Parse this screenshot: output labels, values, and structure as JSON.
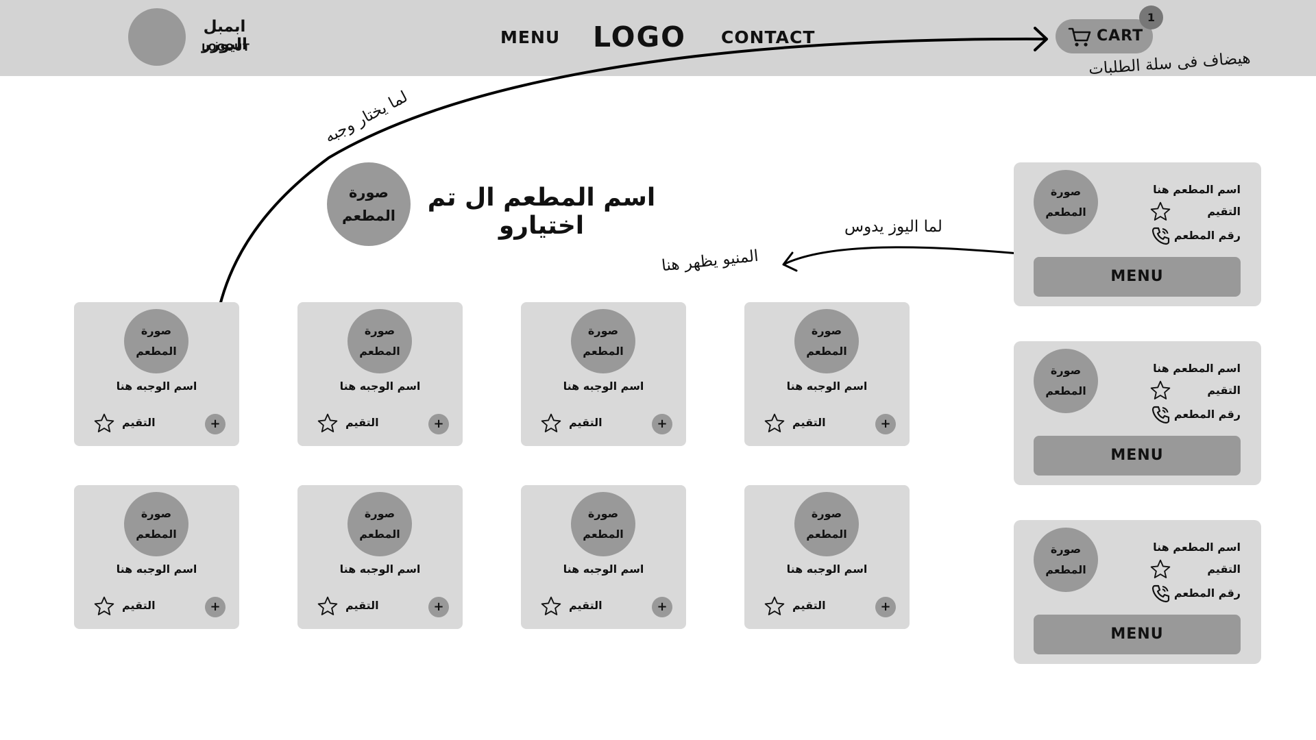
{
  "header": {
    "user_name": "ابمبل اليوزر",
    "logout_label": "LOGOUT",
    "nav_menu_label": "MENU",
    "logo_text": "LOGO",
    "nav_contact_label": "CONTACT",
    "cart_label": "CART",
    "cart_count": "1",
    "cart_icon": "cart-icon"
  },
  "annotations": {
    "cart_note": "هيضاف فى سلة الطلبات",
    "choose_dish_note": "لما يختار وجبه",
    "user_press_note": "لما اليوز يدوس",
    "menu_appears_note": "المنيو يظهر هنا"
  },
  "selected_restaurant": {
    "photo_label": "صورة المطعم",
    "title": "اسم المطعم ال تم اختيارو"
  },
  "dishes": [
    {
      "photo_label": "صورة المطعم",
      "name": "اسم الوجبه هنا",
      "rating_label": "التقيم",
      "add_label": "+"
    },
    {
      "photo_label": "صورة المطعم",
      "name": "اسم الوجبه هنا",
      "rating_label": "التقيم",
      "add_label": "+"
    },
    {
      "photo_label": "صورة المطعم",
      "name": "اسم الوجبه هنا",
      "rating_label": "التقيم",
      "add_label": "+"
    },
    {
      "photo_label": "صورة المطعم",
      "name": "اسم الوجبه هنا",
      "rating_label": "التقيم",
      "add_label": "+"
    },
    {
      "photo_label": "صورة المطعم",
      "name": "اسم الوجبه هنا",
      "rating_label": "التقيم",
      "add_label": "+"
    },
    {
      "photo_label": "صورة المطعم",
      "name": "اسم الوجبه هنا",
      "rating_label": "التقيم",
      "add_label": "+"
    },
    {
      "photo_label": "صورة المطعم",
      "name": "اسم الوجبه هنا",
      "rating_label": "التقيم",
      "add_label": "+"
    },
    {
      "photo_label": "صورة المطعم",
      "name": "اسم الوجبه هنا",
      "rating_label": "التقيم",
      "add_label": "+"
    }
  ],
  "restaurants": [
    {
      "photo_label": "صورة المطعم",
      "name": "اسم المطعم هنا",
      "rating_label": "التقيم",
      "phone_label": "رقم المطعم",
      "menu_label": "MENU"
    },
    {
      "photo_label": "صورة المطعم",
      "name": "اسم المطعم هنا",
      "rating_label": "التقيم",
      "phone_label": "رقم المطعم",
      "menu_label": "MENU"
    },
    {
      "photo_label": "صورة المطعم",
      "name": "اسم المطعم هنا",
      "rating_label": "التقيم",
      "phone_label": "رقم المطعم",
      "menu_label": "MENU"
    }
  ],
  "icons": {
    "star": "star-outline-icon",
    "phone": "phone-icon",
    "add": "plus-icon"
  },
  "colors": {
    "header_bg": "#d3d3d3",
    "card_bg": "#d9d9d9",
    "placeholder_gray": "#999999",
    "text": "#111111"
  }
}
